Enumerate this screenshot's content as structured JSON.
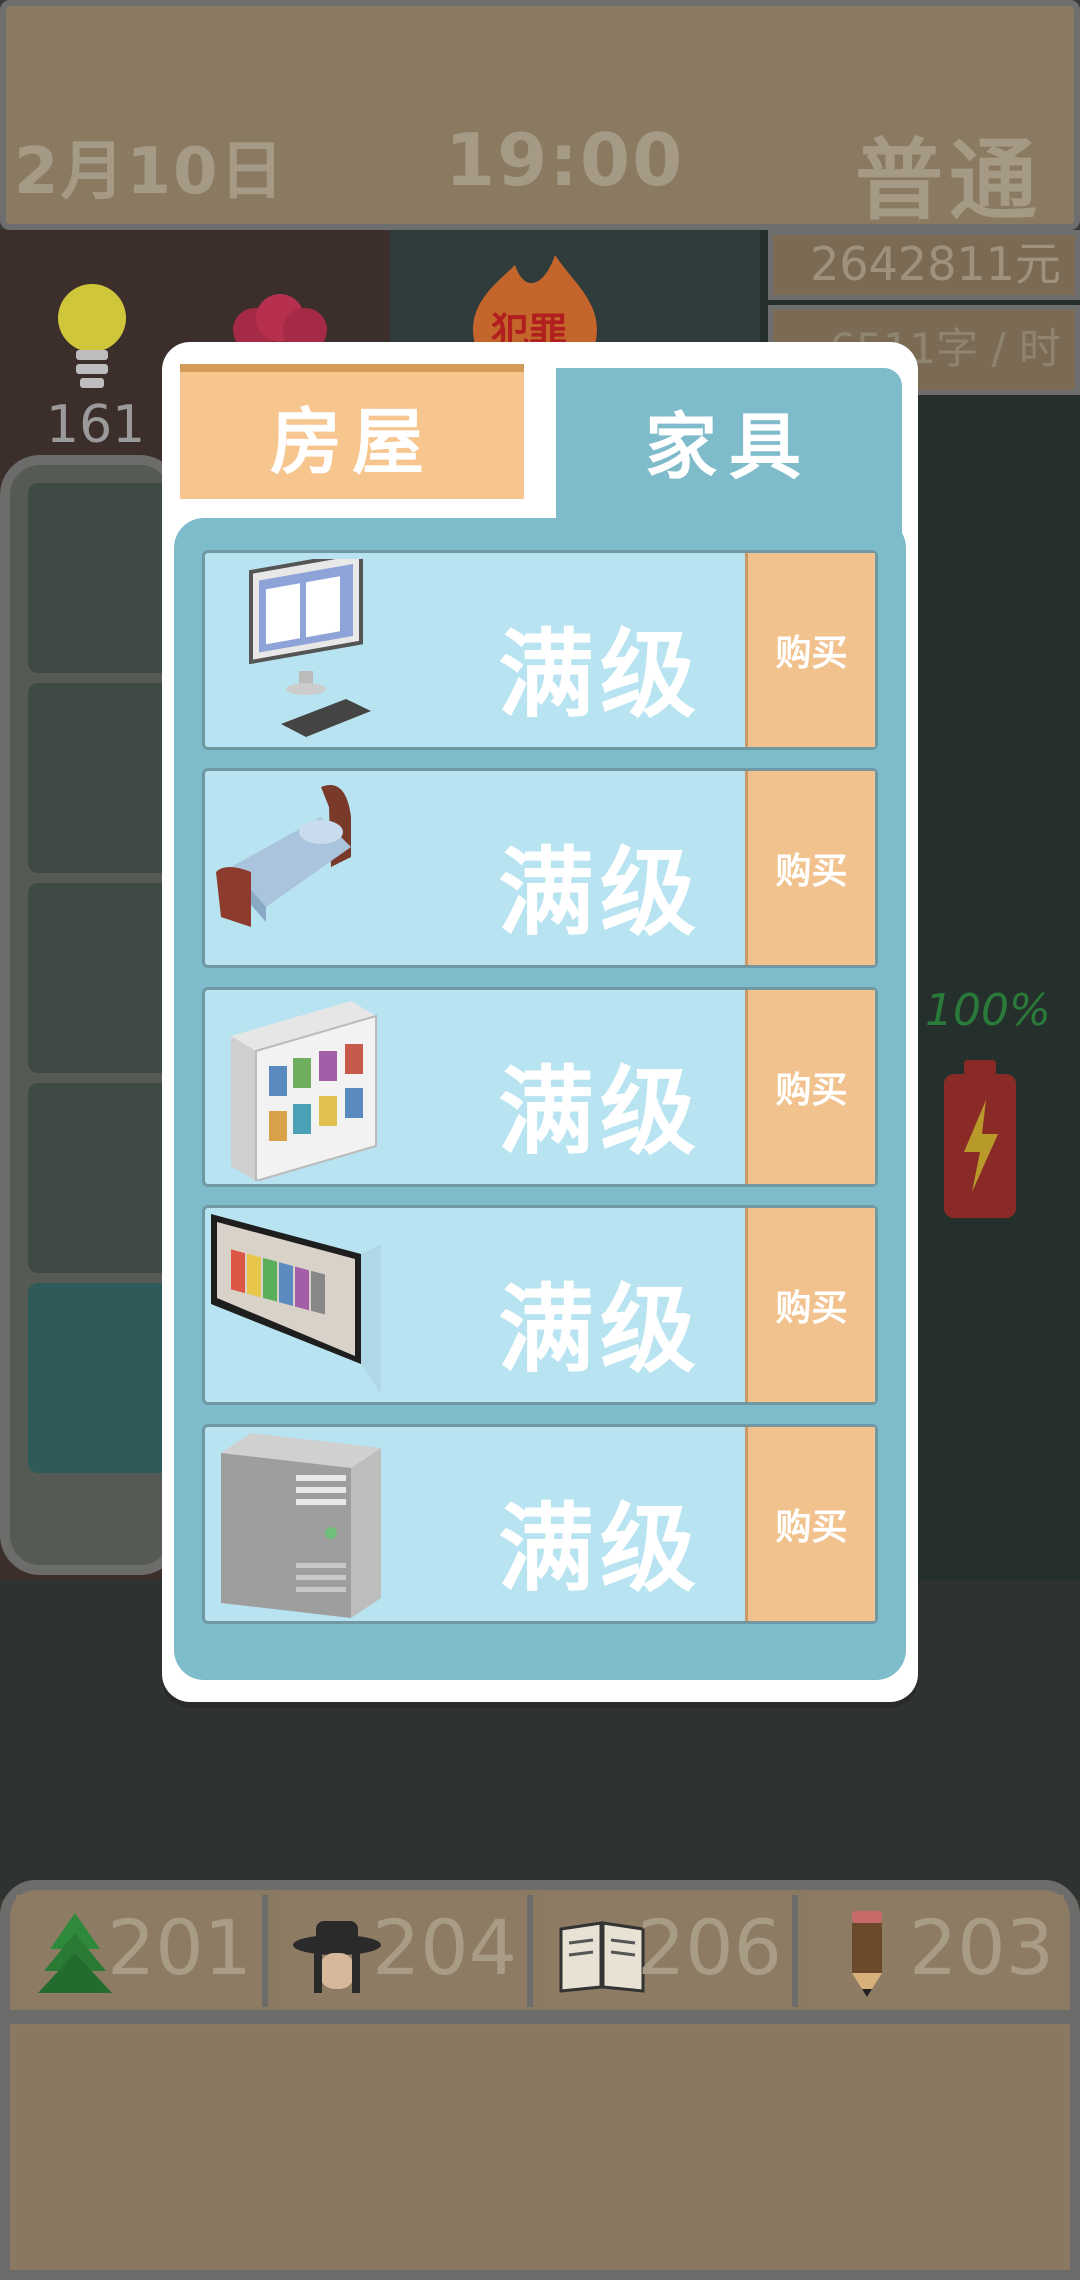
{
  "status": {
    "date": "2月10日",
    "time": "19:00",
    "difficulty": "普通",
    "money": "2642811元",
    "rate": "6511字 / 时",
    "inspiration": "161",
    "crime_badge": "犯罪"
  },
  "battery": {
    "percent_label": "100%",
    "level": 1.0
  },
  "modal": {
    "tabs": [
      {
        "label": "房屋",
        "active": false
      },
      {
        "label": "家具",
        "active": true
      }
    ],
    "items": [
      {
        "icon": "computer-icon",
        "level_label": "满级",
        "buy_label": "购买"
      },
      {
        "icon": "bed-icon",
        "level_label": "满级",
        "buy_label": "购买"
      },
      {
        "icon": "bookshelf-icon",
        "level_label": "满级",
        "buy_label": "购买"
      },
      {
        "icon": "tv-icon",
        "level_label": "满级",
        "buy_label": "购买"
      },
      {
        "icon": "air-conditioner-icon",
        "level_label": "满级",
        "buy_label": "购买"
      }
    ]
  },
  "stats": [
    {
      "icon": "tree-icon",
      "value": "201"
    },
    {
      "icon": "hat-person-icon",
      "value": "204"
    },
    {
      "icon": "book-icon",
      "value": "206"
    },
    {
      "icon": "pencil-icon",
      "value": "203"
    }
  ],
  "colors": {
    "panel": "#8a7a62",
    "modal_bg": "#7fbccb",
    "row_bg": "#b8e4f1",
    "buy_bg": "#f1c28e",
    "tab_inactive": "#f7c58e"
  }
}
